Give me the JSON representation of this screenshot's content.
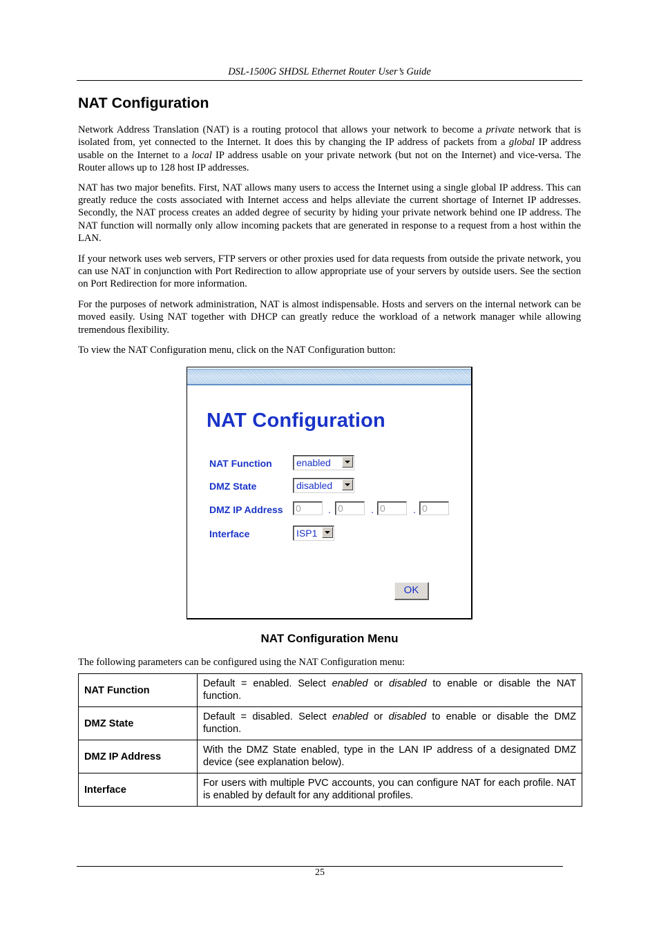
{
  "running_header": "DSL-1500G SHDSL Ethernet Router User’s Guide",
  "section_title": "NAT Configuration",
  "paragraphs": [
    {
      "parts": [
        {
          "t": "Network Address Translation (NAT) is a routing protocol that allows your network to become a "
        },
        {
          "t": "private",
          "i": true
        },
        {
          "t": " network that is isolated from, yet connected to the Internet. It does this by changing the IP address of packets from a "
        },
        {
          "t": "global",
          "i": true
        },
        {
          "t": " IP address usable on the Internet to a "
        },
        {
          "t": "local",
          "i": true
        },
        {
          "t": " IP address usable on your private network (but not on the Internet) and vice-versa. The Router allows up to 128 host IP addresses."
        }
      ]
    },
    {
      "parts": [
        {
          "t": "NAT has two major benefits. First, NAT allows many users to access the Internet using a single global IP address. This can greatly reduce the costs associated with Internet access and helps alleviate the current shortage of Internet IP addresses. Secondly, the NAT process creates an added degree of security by hiding your private network behind one IP address. The NAT function will normally only allow incoming packets that are generated in response to a request from a host within the LAN."
        }
      ]
    },
    {
      "parts": [
        {
          "t": "If your network uses web servers, FTP servers or other proxies used for data requests from outside the private network, you can use NAT in conjunction with Port Redirection to allow appropriate use of your servers by outside users. See the section on Port Redirection for more information."
        }
      ]
    },
    {
      "parts": [
        {
          "t": "For the purposes of network administration, NAT is almost indispensable. Hosts and servers on the internal network can be moved easily. Using NAT together with DHCP can greatly reduce the workload of a network manager while allowing tremendous flexibility."
        }
      ]
    },
    {
      "parts": [
        {
          "t": "To view the NAT Configuration menu, click on the NAT Configuration button:"
        }
      ]
    }
  ],
  "ui_screenshot": {
    "title": "NAT Configuration",
    "title_color": "#1a33c8",
    "fields": {
      "nat_function": {
        "label": "NAT Function",
        "value": "enabled"
      },
      "dmz_state": {
        "label": "DMZ State",
        "value": "disabled"
      },
      "dmz_ip": {
        "label": "DMZ IP Address",
        "octets": [
          "0",
          "0",
          "0",
          "0"
        ],
        "separator": "."
      },
      "interface": {
        "label": "Interface",
        "value": "ISP1"
      }
    },
    "ok_label": "OK"
  },
  "figure_caption": "NAT Configuration Menu",
  "table_intro": "The following parameters can be configured using the NAT Configuration menu:",
  "parameters": [
    {
      "name": "NAT Function",
      "desc": [
        {
          "t": "Default = enabled. Select "
        },
        {
          "t": "enabled",
          "i": true
        },
        {
          "t": " or "
        },
        {
          "t": "disabled",
          "i": true
        },
        {
          "t": " to enable or disable the NAT function."
        }
      ]
    },
    {
      "name": "DMZ State",
      "desc": [
        {
          "t": "Default = disabled. Select "
        },
        {
          "t": "enabled",
          "i": true
        },
        {
          "t": " or "
        },
        {
          "t": "disabled",
          "i": true
        },
        {
          "t": " to enable or disable the DMZ function."
        }
      ]
    },
    {
      "name": "DMZ IP Address",
      "desc": [
        {
          "t": "With the DMZ State enabled, type in the LAN IP address of a designated DMZ device (see explanation below)."
        }
      ]
    },
    {
      "name": "Interface",
      "desc": [
        {
          "t": "For users with multiple PVC accounts, you can configure NAT for each profile. NAT is enabled by default for any additional profiles."
        }
      ]
    }
  ],
  "page_number": "25"
}
